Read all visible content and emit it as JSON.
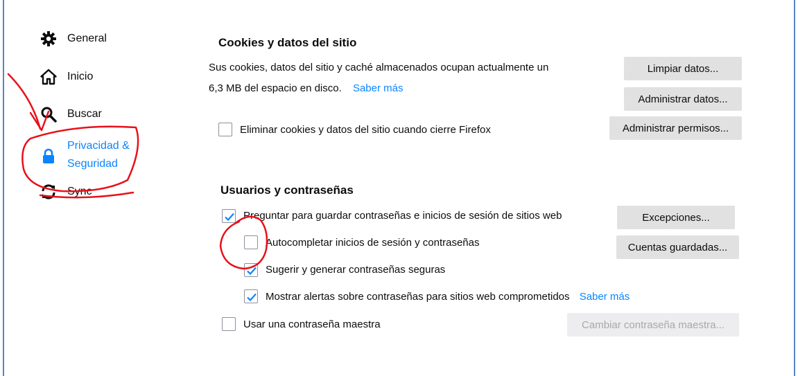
{
  "sidebar": {
    "items": [
      {
        "label": "General",
        "icon": "gear-icon"
      },
      {
        "label": "Inicio",
        "icon": "home-icon"
      },
      {
        "label": "Buscar",
        "icon": "search-icon"
      },
      {
        "label": "Privacidad &",
        "label_line2": "Seguridad",
        "icon": "lock-icon",
        "selected": true
      },
      {
        "label": "Sync",
        "icon": "sync-icon"
      }
    ]
  },
  "cookies": {
    "title": "Cookies y datos del sitio",
    "description_line1": "Sus cookies, datos del sitio y caché almacenados ocupan actualmente un",
    "description_line2": "6,3 MB del espacio en disco.",
    "learn_more": "Saber más",
    "clear_data_button": "Limpiar datos...",
    "manage_data_button": "Administrar datos...",
    "delete_on_close_label": "Eliminar cookies y datos del sitio cuando cierre Firefox",
    "delete_on_close_checked": false,
    "manage_permissions_button": "Administrar permisos..."
  },
  "logins": {
    "title": "Usuarios y contraseñas",
    "ask_to_save_label": "Preguntar para guardar contraseñas e inicios de sesión de sitios web",
    "ask_to_save_checked": true,
    "exceptions_button": "Excepciones...",
    "autofill_label": "Autocompletar inicios de sesión y contraseñas",
    "autofill_checked": false,
    "saved_logins_button": "Cuentas guardadas...",
    "suggest_label": "Sugerir y generar contraseñas seguras",
    "suggest_checked": true,
    "breach_alerts_label": "Mostrar alertas sobre contraseñas para sitios web comprometidos",
    "breach_alerts_checked": true,
    "breach_learn_more": "Saber más",
    "master_password_label": "Usar una contraseña maestra",
    "master_password_checked": false,
    "change_master_button": "Cambiar contraseña maestra..."
  },
  "colors": {
    "accent": "#0a84ff",
    "annotation": "#e8101a",
    "check": "#0a84ff",
    "frame": "#5b83c4"
  }
}
